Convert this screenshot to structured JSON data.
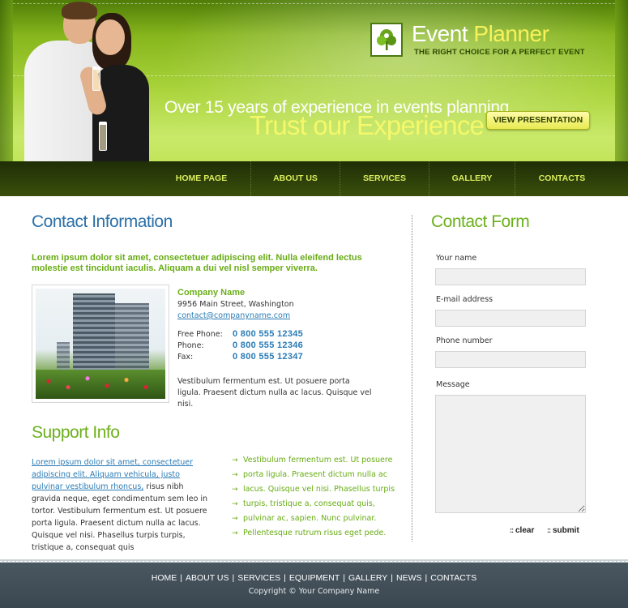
{
  "colors": {
    "brand_green": "#6cb01c",
    "heading_blue": "#2a6fa8",
    "nav_text": "#d8ec5c",
    "logo_yellow": "#f7f25a",
    "footer_bg": "#3b4750"
  },
  "logo": {
    "icon": "tree-leaf-icon",
    "word1": "Event",
    "word2": "Planner",
    "tagline": "THE RIGHT CHOICE FOR A PERFECT EVENT"
  },
  "hero": {
    "line1": "Over 15 years of experience in events planning.",
    "line2": "Trust our Experience",
    "button": "VIEW PRESENTATION"
  },
  "nav": {
    "items": [
      "HOME PAGE",
      "ABOUT US",
      "SERVICES",
      "GALLERY",
      "CONTACTS"
    ]
  },
  "contact_info": {
    "title": "Contact Information",
    "intro": "Lorem ipsum dolor sit amet, consectetuer adipiscing elit. Nulla eleifend lectus molestie est tincidunt iaculis. Aliquam a dui vel nisl semper viverra.",
    "company_name": "Company Name",
    "address": "9956 Main Street, Washington",
    "email": "contact@companyname.com",
    "phones": [
      {
        "label": "Free Phone:",
        "value": "0 800 555 12345"
      },
      {
        "label": "Phone:",
        "value": "0 800 555 12346"
      },
      {
        "label": "Fax:",
        "value": "0 800 555 12347"
      }
    ],
    "description": "Vestibulum fermentum est. Ut posuere porta ligula. Praesent dictum nulla ac lacus. Quisque vel nisi."
  },
  "support": {
    "title": "Support Info",
    "link_text": "Lorem ipsum dolor sit amet, consectetuer adipiscing elit. Aliquam vehicula, justo pulvinar vestibulum rhoncus,",
    "body_text": " risus nibh gravida neque, eget condimentum sem leo in tortor. Vestibulum fermentum est. Ut posuere porta ligula. Praesent dictum nulla ac lacus. Quisque vel nisi. Phasellus turpis turpis, tristique a, consequat quis",
    "list": [
      "Vestibulum fermentum est. Ut posuere",
      "porta ligula. Praesent dictum nulla ac",
      "lacus. Quisque vel nisi. Phasellus turpis",
      "turpis, tristique a, consequat quis,",
      "pulvinar ac, sapien. Nunc pulvinar.",
      "Pellentesque rutrum risus eget pede."
    ]
  },
  "contact_form": {
    "title": "Contact Form",
    "name_label": "Your name",
    "name_value": "",
    "email_label": "E-mail address",
    "email_value": "",
    "phone_label": "Phone number",
    "phone_value": "",
    "message_label": "Message",
    "message_value": "",
    "clear_label": "clear",
    "submit_label": "submit"
  },
  "footer": {
    "links": [
      "HOME",
      "ABOUT US",
      "SERVICES",
      "EQUIPMENT",
      "GALLERY",
      "NEWS",
      "CONTACTS"
    ],
    "separator": "|",
    "copyright": "Copyright © Your Company Name"
  }
}
